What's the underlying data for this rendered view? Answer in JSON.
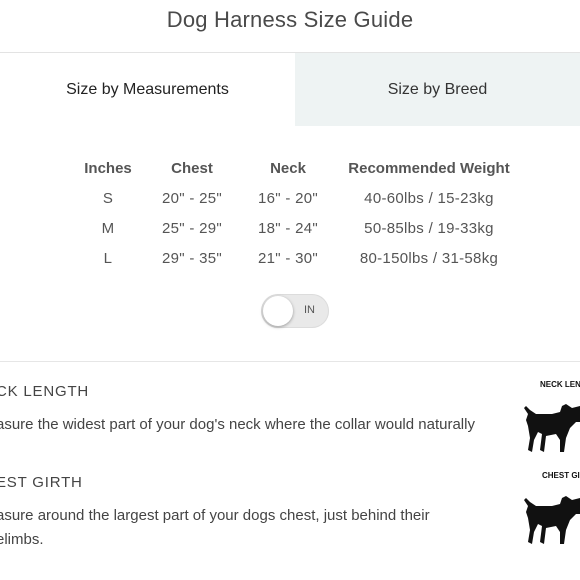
{
  "header": {
    "title": "Dog Harness Size Guide"
  },
  "tabs": [
    {
      "label": "Size by Measurements",
      "active": true
    },
    {
      "label": "Size by Breed",
      "active": false
    }
  ],
  "size_table": {
    "headers": [
      "Inches",
      "Chest",
      "Neck",
      "Recommended Weight"
    ],
    "rows": [
      [
        "S",
        "20\" - 25\"",
        "16\" - 20\"",
        "40-60lbs / 15-23kg"
      ],
      [
        "M",
        "25\" - 29\"",
        "18\" - 24\"",
        "50-85lbs / 19-33kg"
      ],
      [
        "L",
        "29\" - 35\"",
        "21\" - 30\"",
        "80-150lbs / 31-58kg"
      ]
    ]
  },
  "unit_toggle": {
    "label": "IN",
    "state": "off"
  },
  "sections": [
    {
      "title": "CK LENGTH",
      "text": "asure the widest part of your dog's neck where the collar would naturally",
      "figure_label": "NECK LENG",
      "icon": "dog-silhouette-icon"
    },
    {
      "title": "EST GIRTH",
      "text_line1": "asure around the largest part of your dogs chest, just behind their",
      "text_line2": "elimbs.",
      "figure_label": "CHEST GIR",
      "icon": "dog-silhouette-icon"
    }
  ],
  "colors": {
    "inactive_tab_bg": "#eef3f3",
    "text": "#444444",
    "divider": "#e6e6e6"
  }
}
